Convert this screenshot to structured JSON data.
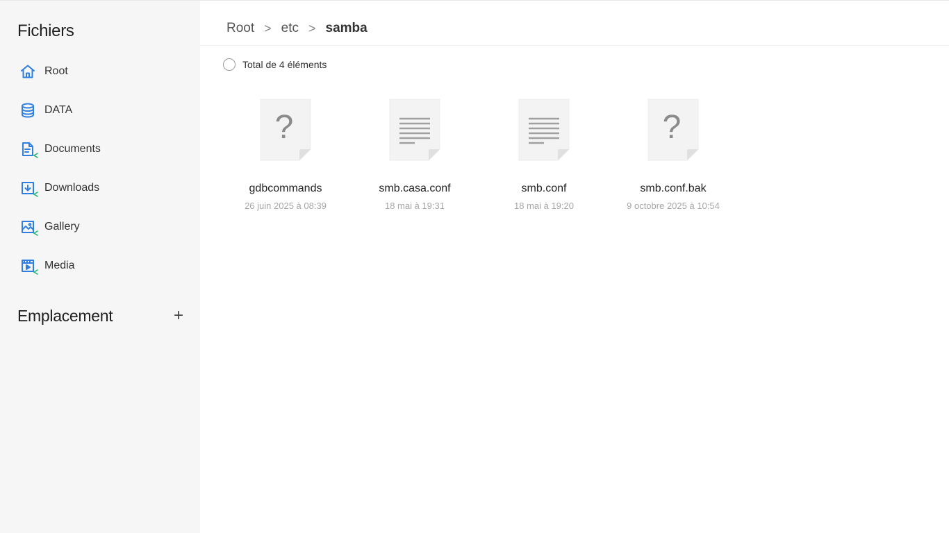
{
  "sidebar": {
    "title": "Fichiers",
    "items": [
      {
        "label": "Root",
        "icon": "home-icon",
        "shared": false
      },
      {
        "label": "DATA",
        "icon": "database-icon",
        "shared": false
      },
      {
        "label": "Documents",
        "icon": "document-icon",
        "shared": true
      },
      {
        "label": "Downloads",
        "icon": "download-icon",
        "shared": true
      },
      {
        "label": "Gallery",
        "icon": "gallery-icon",
        "shared": true
      },
      {
        "label": "Media",
        "icon": "media-icon",
        "shared": true
      }
    ],
    "emplacement": {
      "title": "Emplacement",
      "add_label": "+"
    }
  },
  "breadcrumb": {
    "items": [
      "Root",
      "etc",
      "samba"
    ],
    "separator": ">"
  },
  "toolbar": {
    "total_label": "Total de 4 éléments",
    "selected": false
  },
  "files": [
    {
      "name": "gdbcommands",
      "date": "26 juin 2025 à 08:39",
      "type": "unknown",
      "icon": "unknown-file-icon"
    },
    {
      "name": "smb.casa.conf",
      "date": "18 mai à 19:31",
      "type": "text",
      "icon": "text-file-icon"
    },
    {
      "name": "smb.conf",
      "date": "18 mai à 19:20",
      "type": "text",
      "icon": "text-file-icon"
    },
    {
      "name": "smb.conf.bak",
      "date": "9 octobre 2025 à 10:54",
      "type": "unknown",
      "icon": "unknown-file-icon"
    }
  ],
  "colors": {
    "accent": "#2f7fe0",
    "share_badge": "#1fb76b",
    "sidebar_bg": "#f6f6f7"
  }
}
